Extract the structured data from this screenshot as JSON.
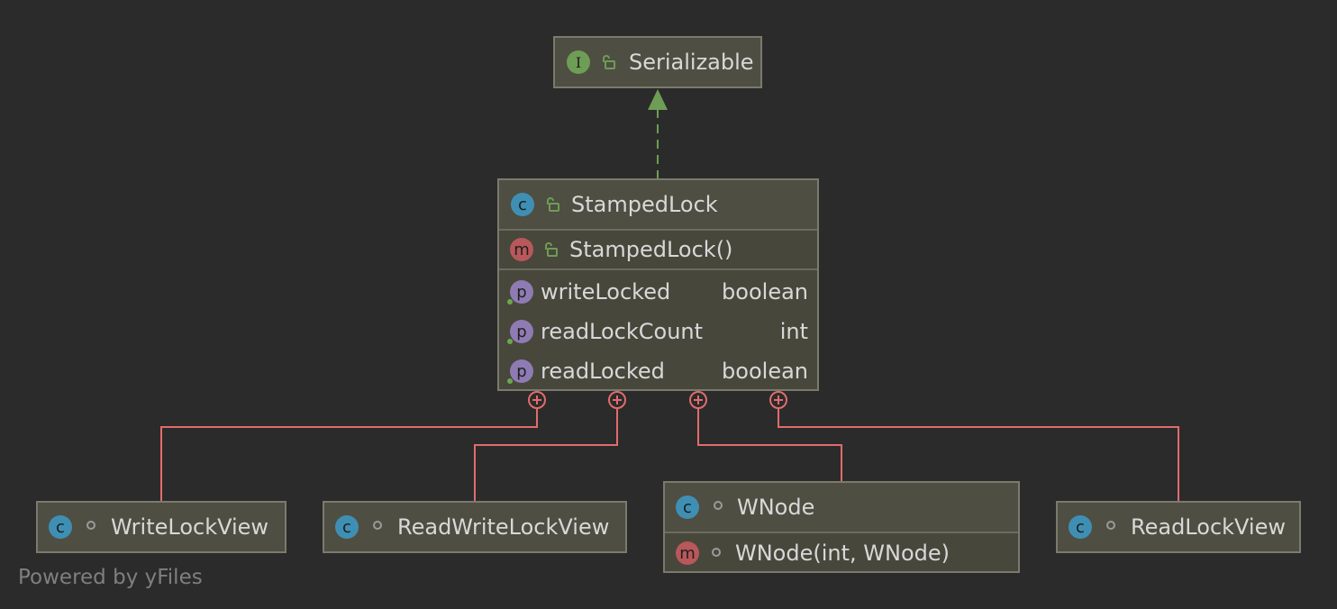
{
  "diagram": {
    "interface": {
      "name": "Serializable",
      "badge": "I"
    },
    "main_class": {
      "name": "StampedLock",
      "badge": "c",
      "constructor": {
        "badge": "m",
        "label": "StampedLock()"
      },
      "properties": [
        {
          "badge": "p",
          "name": "writeLocked",
          "type": "boolean"
        },
        {
          "badge": "p",
          "name": "readLockCount",
          "type": "int"
        },
        {
          "badge": "p",
          "name": "readLocked",
          "type": "boolean"
        }
      ]
    },
    "inner_classes": [
      {
        "name": "WriteLockView",
        "badge": "c"
      },
      {
        "name": "ReadWriteLockView",
        "badge": "c"
      },
      {
        "name": "WNode",
        "badge": "c",
        "constructor": {
          "badge": "m",
          "label": "WNode(int, WNode)"
        }
      },
      {
        "name": "ReadLockView",
        "badge": "c"
      }
    ],
    "watermark": "Powered by yFiles",
    "colors": {
      "background": "#2b2b2b",
      "node_fill": "#48473c",
      "node_border": "#7a7a6e",
      "implements_edge": "#6e9d55",
      "inner_class_edge": "#e06c6c",
      "class_badge": "#3f8fb4",
      "method_badge": "#b8585a",
      "property_badge": "#8f7bb3",
      "interface_badge": "#6e9d55"
    }
  }
}
